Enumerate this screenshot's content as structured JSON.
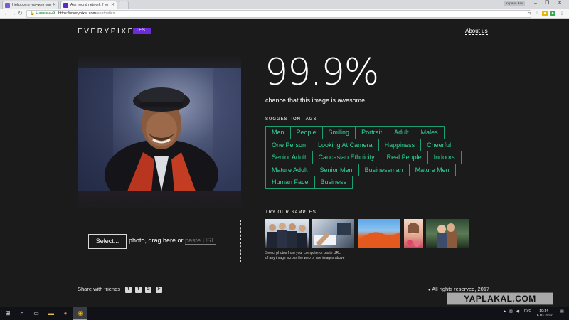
{
  "browser": {
    "tabs": [
      {
        "label": "Нейросеть научили опр",
        "color": "#7b5bd1",
        "active": false
      },
      {
        "label": "Ask neural network if yo",
        "color": "#5b2ac8",
        "active": true
      }
    ],
    "user_label": "Кирилл Бак",
    "back_icon": "back-arrow-icon",
    "forward_icon": "forward-arrow-icon",
    "reload_icon": "reload-icon",
    "secure_label": "Надежный",
    "url_host": "https://everypixel.com",
    "url_path": "/aesthetics"
  },
  "header": {
    "logo": "EVERYPIXEL",
    "badge": "TEST",
    "about_link": "About us"
  },
  "result": {
    "score": "99.9%",
    "subtitle": "chance that this image is awesome"
  },
  "suggestion": {
    "title": "SUGGESTION TAGS",
    "rows": [
      [
        "Men",
        "People",
        "Smiling",
        "Portrait",
        "Adult",
        "Males"
      ],
      [
        "One Person",
        "Looking At Camera",
        "Happiness",
        "Cheerful"
      ],
      [
        "Senior Adult",
        "Caucasian Ethnicity",
        "Real People",
        "Indoors"
      ],
      [
        "Mature Adult",
        "Senior Men",
        "Businessman",
        "Mature Men"
      ],
      [
        "Human Face",
        "Business"
      ]
    ],
    "border_color": "#1e9c72",
    "text_color": "#2ed699"
  },
  "upload": {
    "select_button": "Select...",
    "text": "photo, drag here or ",
    "link": "paste URL"
  },
  "samples": {
    "title": "TRY OUR SAMPLES",
    "items": [
      {
        "name": "sample-business-people"
      },
      {
        "name": "sample-office-desk"
      },
      {
        "name": "sample-desert-dune"
      },
      {
        "name": "sample-girl-flowers"
      },
      {
        "name": "sample-couple-forest"
      }
    ],
    "note_line1": "Select photos from your computer or paste URL",
    "note_line2": "of any image across the web or use images above"
  },
  "footer": {
    "share_label": "Share with friends",
    "social": [
      {
        "name": "twitter-icon",
        "glyph": "t"
      },
      {
        "name": "facebook-icon",
        "glyph": "f"
      },
      {
        "name": "google-icon",
        "glyph": "G"
      },
      {
        "name": "telegram-icon",
        "glyph": "➤"
      }
    ],
    "rights": "All rights reserved, 2017"
  },
  "taskbar": {
    "lang": "РУС",
    "time": "10:14",
    "date": "16.03.2017"
  },
  "watermark": "YAPLAKAL.COM"
}
